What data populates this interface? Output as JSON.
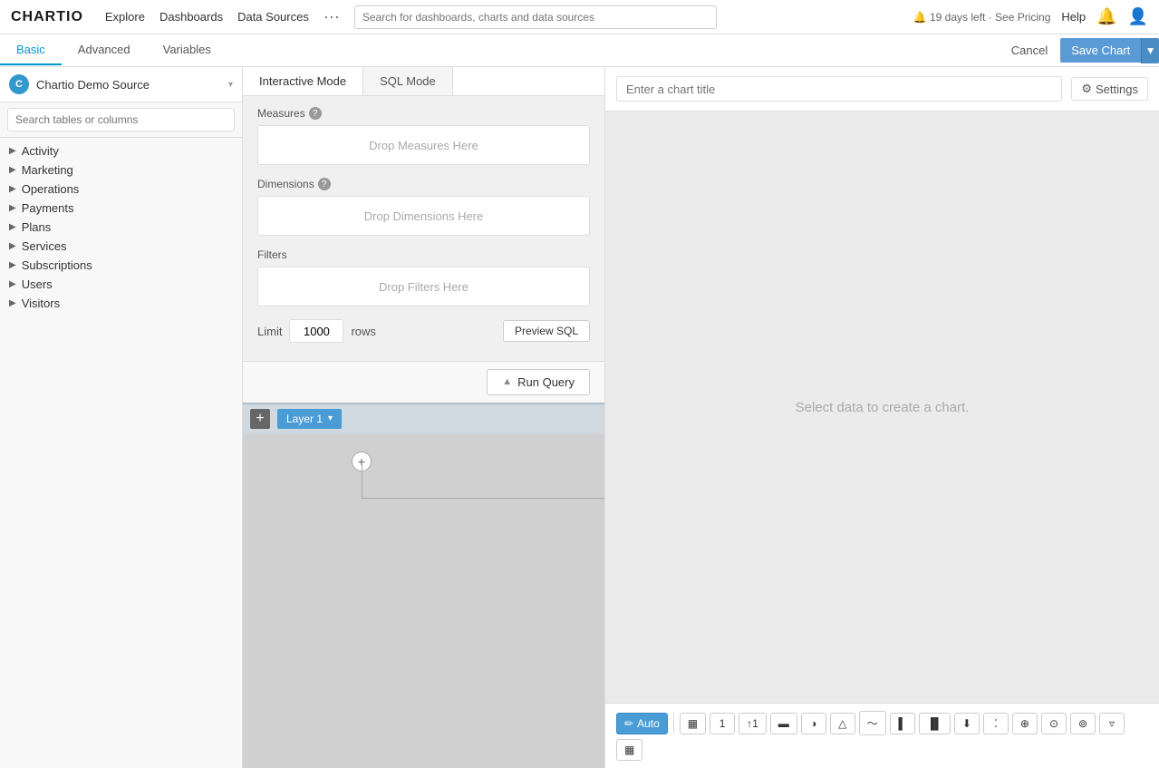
{
  "app": {
    "logo": "CHARTIO",
    "nav": {
      "explore": "Explore",
      "dashboards": "Dashboards",
      "data_sources": "Data Sources",
      "dots": "···",
      "search_placeholder": "Search for dashboards, charts and data sources",
      "trial": "🔔 19 days left · See Pricing",
      "help": "Help",
      "bell_icon": "🔔",
      "user_icon": "👤"
    }
  },
  "tabs": {
    "basic": "Basic",
    "advanced": "Advanced",
    "variables": "Variables",
    "cancel": "Cancel",
    "save_chart": "Save Chart"
  },
  "left_panel": {
    "source_badge": "C",
    "source_name": "Chartio Demo Source",
    "search_placeholder": "Search tables or columns",
    "tree_items": [
      {
        "label": "Activity",
        "expanded": false
      },
      {
        "label": "Marketing",
        "expanded": false
      },
      {
        "label": "Operations",
        "expanded": false
      },
      {
        "label": "Payments",
        "expanded": false
      },
      {
        "label": "Plans",
        "expanded": false
      },
      {
        "label": "Services",
        "expanded": false
      },
      {
        "label": "Subscriptions",
        "expanded": false
      },
      {
        "label": "Users",
        "expanded": false
      },
      {
        "label": "Visitors",
        "expanded": false
      }
    ]
  },
  "query_panel": {
    "mode_tabs": [
      {
        "label": "Interactive Mode",
        "active": true
      },
      {
        "label": "SQL Mode",
        "active": false
      }
    ],
    "measures_label": "Measures",
    "dimensions_label": "Dimensions",
    "filters_label": "Filters",
    "drop_measures": "Drop Measures Here",
    "drop_dimensions": "Drop Dimensions Here",
    "drop_filters": "Drop Filters Here",
    "limit_label": "Limit",
    "limit_value": "1000",
    "rows_label": "rows",
    "preview_sql": "Preview SQL",
    "run_query": "Run Query"
  },
  "layers": {
    "add_icon": "+",
    "layer1_label": "Layer 1"
  },
  "right_panel": {
    "title_placeholder": "Enter a chart title",
    "settings_label": "Settings",
    "empty_message": "Select data to create a chart.",
    "toolbar": {
      "auto_label": "Auto",
      "tools": [
        {
          "icon": "≡",
          "name": "table",
          "label": "Table"
        },
        {
          "icon": "1",
          "name": "single-value",
          "label": "Single Value"
        },
        {
          "icon": "↑1",
          "name": "value-change",
          "label": "Value Change"
        },
        {
          "icon": "⊟",
          "name": "bar-chart",
          "label": "Bar Chart"
        },
        {
          "icon": "◕",
          "name": "pie-chart",
          "label": "Pie Chart"
        },
        {
          "icon": "△",
          "name": "area-chart",
          "label": "Area Chart"
        },
        {
          "icon": "〜",
          "name": "line-chart",
          "label": "Line Chart"
        },
        {
          "icon": "▌",
          "name": "column-chart",
          "label": "Column Chart"
        },
        {
          "icon": "▣",
          "name": "grouped-chart",
          "label": "Grouped Chart"
        },
        {
          "icon": "↓",
          "name": "funnel",
          "label": "Funnel"
        },
        {
          "icon": "⁞⁞",
          "name": "scatter",
          "label": "Scatter"
        },
        {
          "icon": "⊕",
          "name": "bubble",
          "label": "Bubble"
        },
        {
          "icon": "⊙",
          "name": "map1",
          "label": "Map 1"
        },
        {
          "icon": "⊚",
          "name": "map2",
          "label": "Map 2"
        },
        {
          "icon": "▿",
          "name": "filter",
          "label": "Filter"
        },
        {
          "icon": "▦",
          "name": "image",
          "label": "Image"
        }
      ]
    }
  },
  "colors": {
    "accent": "#4a9cd6",
    "accent_dark": "#3a8bc5",
    "bg_light": "#f8f8f8",
    "border": "#ddd"
  }
}
